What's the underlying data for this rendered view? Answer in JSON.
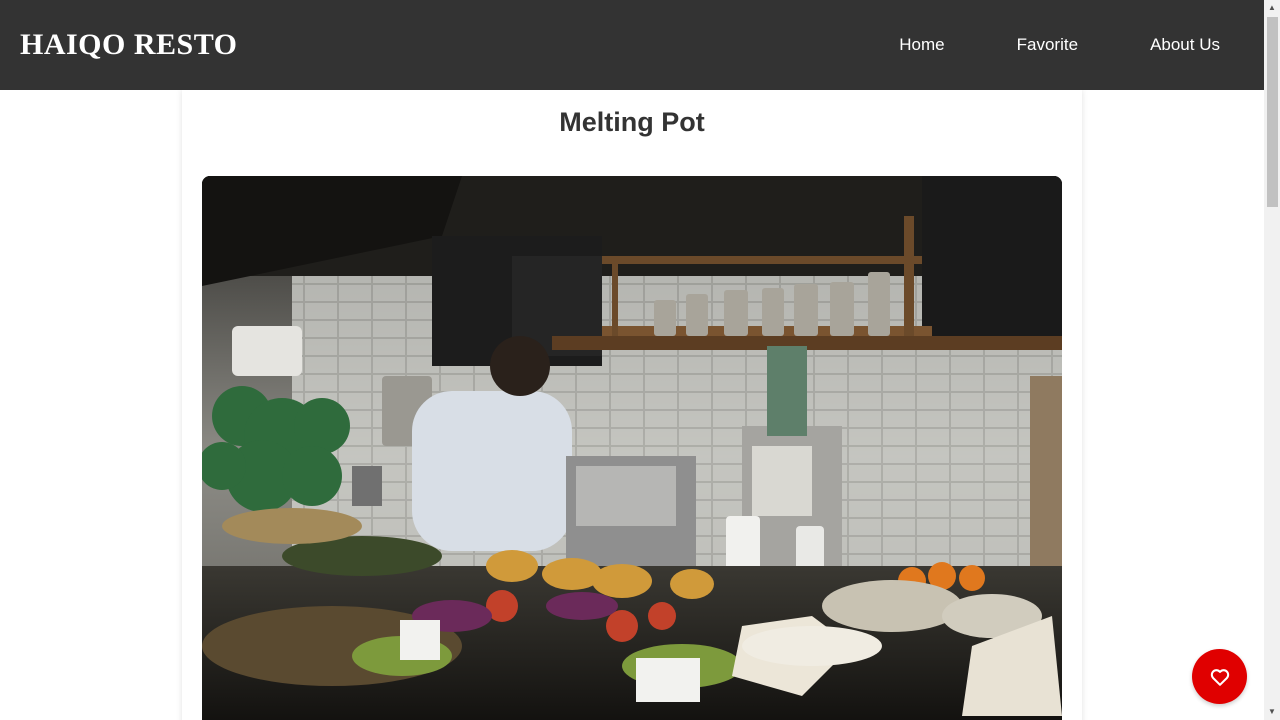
{
  "navbar": {
    "brand": "HAIQO RESTO",
    "links": [
      "Home",
      "Favorite",
      "About Us"
    ]
  },
  "restaurant": {
    "name": "Melting Pot",
    "image_alt": "Melting Pot"
  },
  "favorite_button": {
    "icon": "heart-outline-icon",
    "color": "#e00000"
  },
  "colors": {
    "navbar_bg": "#333333",
    "accent": "#e00000"
  }
}
